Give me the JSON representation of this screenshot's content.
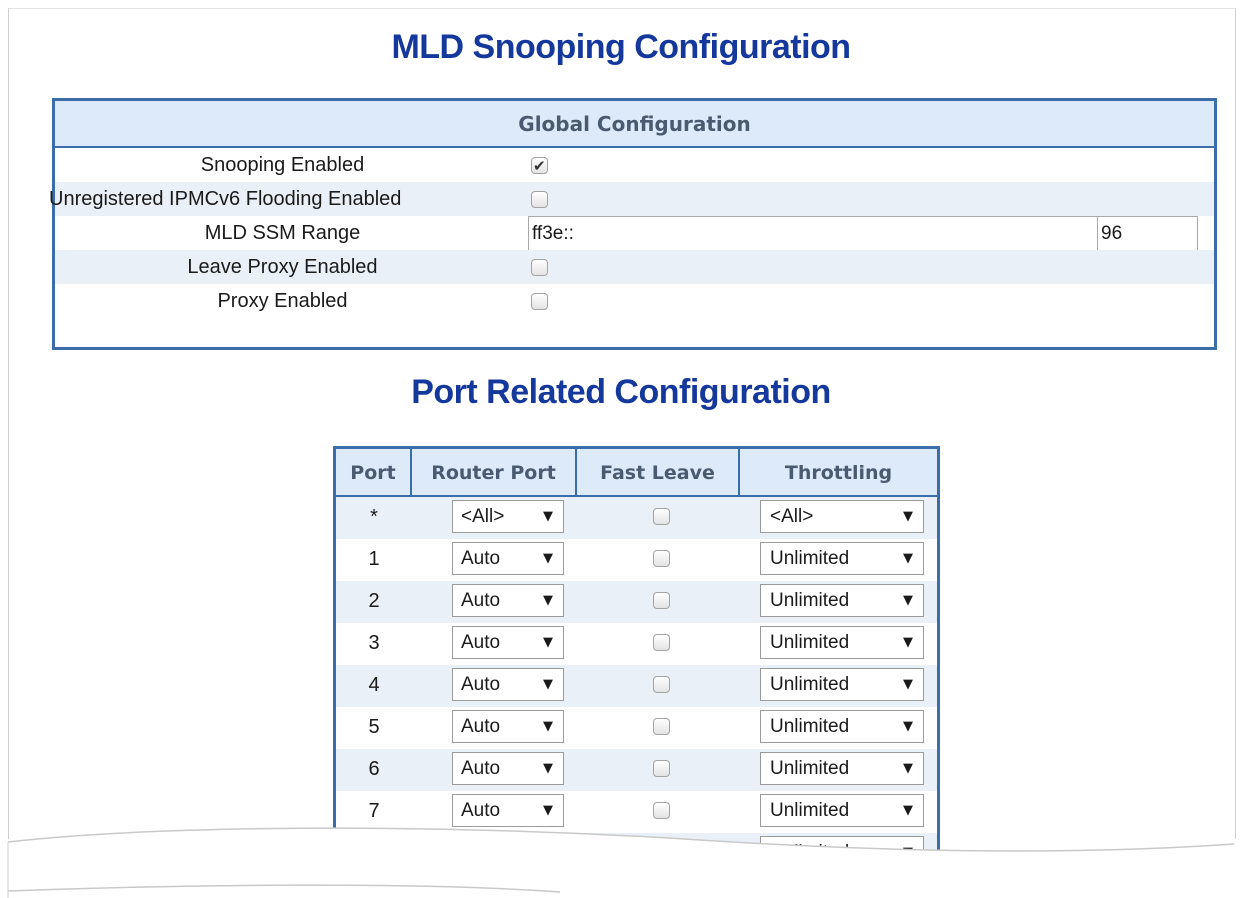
{
  "page": {
    "title": "MLD Snooping Configuration",
    "port_section_title": "Port Related Configuration"
  },
  "global": {
    "header": "Global Configuration",
    "snooping_enabled": {
      "label": "Snooping Enabled",
      "checked": true
    },
    "unregistered_flooding": {
      "label": "Unregistered IPMCv6 Flooding Enabled",
      "checked": false
    },
    "ssm_range": {
      "label": "MLD SSM Range",
      "prefix": "ff3e::",
      "separator": "/",
      "length": "96"
    },
    "leave_proxy": {
      "label": "Leave Proxy Enabled",
      "checked": false
    },
    "proxy": {
      "label": "Proxy Enabled",
      "checked": false
    }
  },
  "ports": {
    "headers": {
      "port": "Port",
      "router_port": "Router Port",
      "fast_leave": "Fast Leave",
      "throttling": "Throttling"
    },
    "rows": [
      {
        "port": "*",
        "router_port": "<All>",
        "fast_leave": false,
        "throttling": "<All>"
      },
      {
        "port": "1",
        "router_port": "Auto",
        "fast_leave": false,
        "throttling": "Unlimited"
      },
      {
        "port": "2",
        "router_port": "Auto",
        "fast_leave": false,
        "throttling": "Unlimited"
      },
      {
        "port": "3",
        "router_port": "Auto",
        "fast_leave": false,
        "throttling": "Unlimited"
      },
      {
        "port": "4",
        "router_port": "Auto",
        "fast_leave": false,
        "throttling": "Unlimited"
      },
      {
        "port": "5",
        "router_port": "Auto",
        "fast_leave": false,
        "throttling": "Unlimited"
      },
      {
        "port": "6",
        "router_port": "Auto",
        "fast_leave": false,
        "throttling": "Unlimited"
      },
      {
        "port": "7",
        "router_port": "Auto",
        "fast_leave": false,
        "throttling": "Unlimited"
      },
      {
        "port": "",
        "router_port": "",
        "fast_leave": false,
        "throttling": "Unlimited"
      }
    ],
    "dropdown_arrow_icon": "triangle-down"
  },
  "colors": {
    "title": "#14389c",
    "table_border": "#3b6ea8",
    "header_bg": "#ddeafa",
    "alt_row_bg": "#eaf0f7"
  }
}
